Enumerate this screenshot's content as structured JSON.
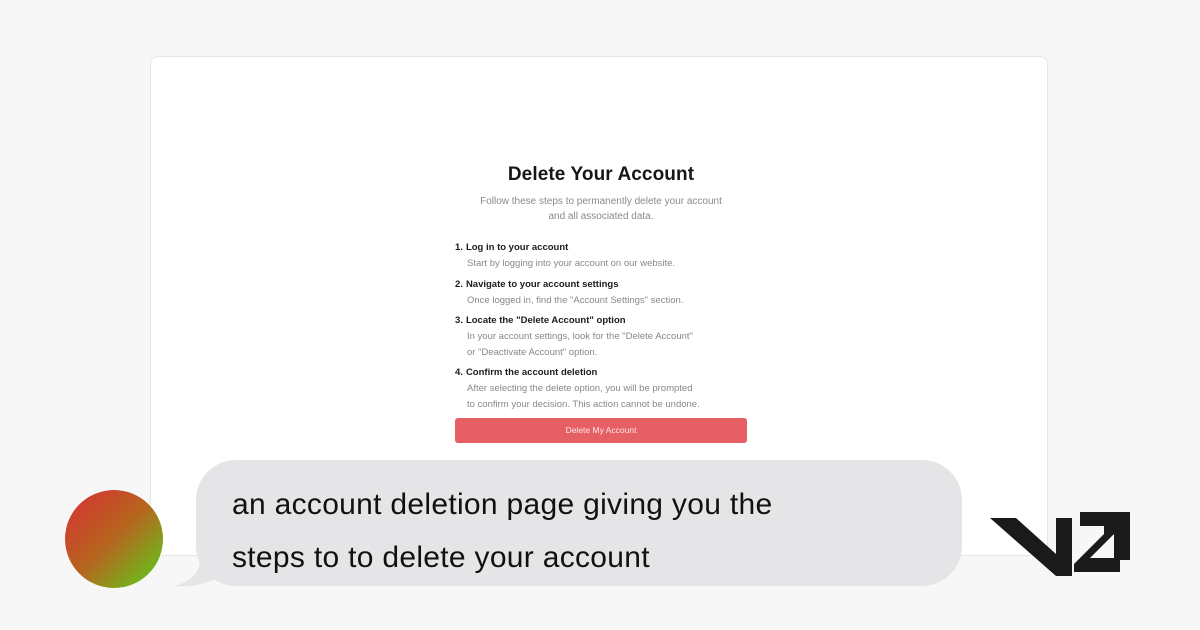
{
  "page": {
    "title": "Delete Your Account",
    "subtitle_line1": "Follow these steps to permanently delete your account",
    "subtitle_line2": "and all associated data.",
    "steps": [
      {
        "num": "1.",
        "title": "Log in to your account",
        "desc_line1": "Start by logging into your account on our website.",
        "desc_line2": ""
      },
      {
        "num": "2.",
        "title": "Navigate to your account settings",
        "desc_line1": "Once logged in, find the \"Account Settings\" section.",
        "desc_line2": ""
      },
      {
        "num": "3.",
        "title": "Locate the \"Delete Account\" option",
        "desc_line1": "In your account settings, look for the \"Delete Account\"",
        "desc_line2": "or \"Deactivate Account\" option."
      },
      {
        "num": "4.",
        "title": "Confirm the account deletion",
        "desc_line1": "After selecting the delete option, you will be prompted",
        "desc_line2": "to confirm your decision. This action cannot be undone."
      }
    ],
    "button_label": "Delete My Account"
  },
  "caption": {
    "line1": "an account deletion page giving you the",
    "line2": "steps to to delete your account"
  },
  "colors": {
    "button": "#e65f65",
    "bubble": "#e5e5e7",
    "avatar_start": "#da2d36",
    "avatar_end": "#57d41a",
    "logo": "#1a1a1a"
  },
  "icons": {
    "avatar": "gradient-circle-avatar",
    "logo": "v0-logo"
  }
}
